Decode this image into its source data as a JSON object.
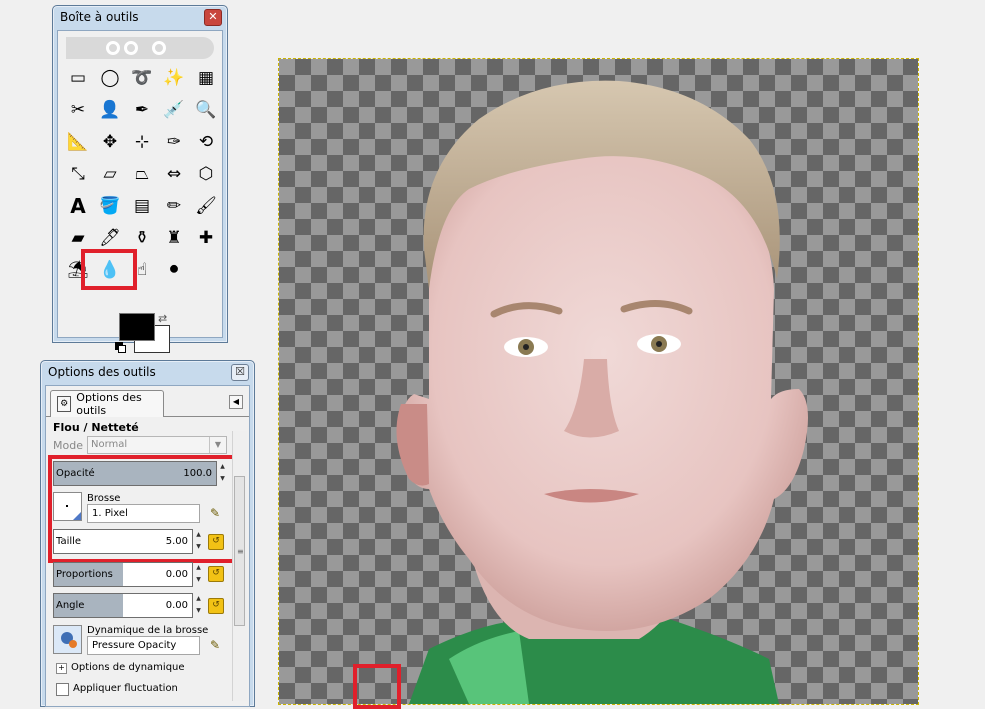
{
  "toolbox": {
    "title": "Boîte à outils",
    "close_label": "✕",
    "tools": [
      {
        "name": "rect-select-tool",
        "icon": "▭"
      },
      {
        "name": "ellipse-select-tool",
        "icon": "◯"
      },
      {
        "name": "free-select-tool",
        "icon": "➰"
      },
      {
        "name": "fuzzy-select-tool",
        "icon": "✨"
      },
      {
        "name": "color-select-tool",
        "icon": "▦"
      },
      {
        "name": "scissors-tool",
        "icon": "✂"
      },
      {
        "name": "foreground-select-tool",
        "icon": "👤"
      },
      {
        "name": "paths-tool",
        "icon": "✒"
      },
      {
        "name": "color-picker-tool",
        "icon": "💉"
      },
      {
        "name": "zoom-tool",
        "icon": "🔍"
      },
      {
        "name": "measure-tool",
        "icon": "📐"
      },
      {
        "name": "move-tool",
        "icon": "✥"
      },
      {
        "name": "align-tool",
        "icon": "⊹"
      },
      {
        "name": "crop-tool",
        "icon": "✑"
      },
      {
        "name": "rotate-tool",
        "icon": "⟲"
      },
      {
        "name": "scale-tool",
        "icon": "⤡"
      },
      {
        "name": "shear-tool",
        "icon": "▱"
      },
      {
        "name": "perspective-tool",
        "icon": "⏢"
      },
      {
        "name": "flip-tool",
        "icon": "⇔"
      },
      {
        "name": "cage-tool",
        "icon": "⬡"
      },
      {
        "name": "text-tool",
        "icon": "A"
      },
      {
        "name": "bucket-fill-tool",
        "icon": "🪣"
      },
      {
        "name": "blend-tool",
        "icon": "▤"
      },
      {
        "name": "pencil-tool",
        "icon": "✏"
      },
      {
        "name": "paintbrush-tool",
        "icon": "🖌"
      },
      {
        "name": "eraser-tool",
        "icon": "▰"
      },
      {
        "name": "airbrush-tool",
        "icon": "🖊"
      },
      {
        "name": "ink-tool",
        "icon": "⚱"
      },
      {
        "name": "clone-tool",
        "icon": "♜"
      },
      {
        "name": "heal-tool",
        "icon": "✚"
      },
      {
        "name": "perspective-clone-tool",
        "icon": "⛱"
      },
      {
        "name": "blur-sharpen-tool",
        "icon": "💧"
      },
      {
        "name": "smudge-tool",
        "icon": "☝"
      },
      {
        "name": "dodge-burn-tool",
        "icon": "⚫"
      }
    ],
    "colors": {
      "foreground": "#000000",
      "background": "#ffffff",
      "highlight": "#e0202b"
    }
  },
  "options": {
    "title": "Options des outils",
    "close_label": "☒",
    "tab_label": "Options des outils",
    "tab_menu": "◀",
    "tool_name": "Flou / Netteté",
    "mode_label": "Mode :",
    "mode_value": "Normal",
    "opacity": {
      "label": "Opacité",
      "value": "100.0",
      "fraction": 1.0
    },
    "brush": {
      "label": "Brosse",
      "value": "1. Pixel"
    },
    "size": {
      "label": "Taille",
      "value": "5.00"
    },
    "proportions": {
      "label": "Proportions",
      "value": "0.00",
      "fraction": 0.5
    },
    "angle": {
      "label": "Angle",
      "value": "0.00",
      "fraction": 0.5
    },
    "dynamics": {
      "label": "Dynamique de la brosse",
      "value": "Pressure Opacity"
    },
    "dynamics_options": "Options de dynamique",
    "jitter": "Appliquer fluctuation"
  }
}
